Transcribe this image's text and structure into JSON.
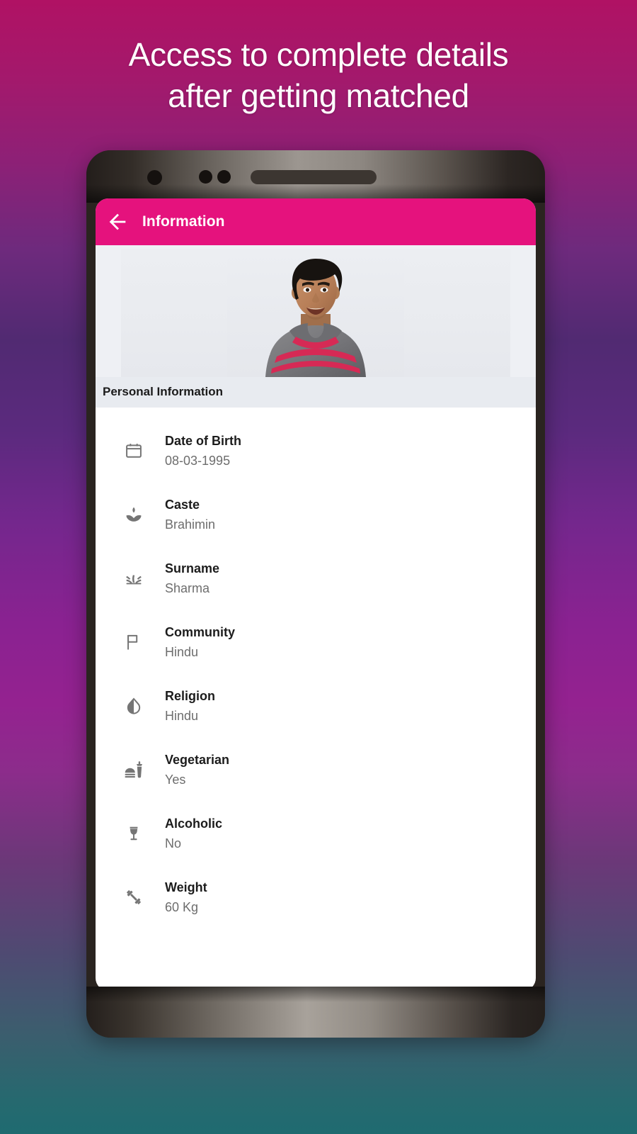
{
  "promo": {
    "headline_line1": "Access to complete details",
    "headline_line2": "after getting matched",
    "text_color": "#ffffff"
  },
  "theme": {
    "accent_pink": "#e5127d",
    "section_band": "#e8ebf0",
    "label_color": "#1c1c1c",
    "value_color": "#6d6d6d",
    "icon_color": "#6e6e6e",
    "bg_top": "#b01264",
    "bg_mid": "#8a2291",
    "bg_bottom": "#1f6b70"
  },
  "appbar": {
    "back_icon": "arrow-left-icon",
    "title": "Information"
  },
  "profile_photo": {
    "alt": "profile-photo-young-man-grey-hoodie"
  },
  "section": {
    "title": "Personal Information"
  },
  "details": [
    {
      "icon": "calendar-icon",
      "label": "Date of Birth",
      "value": "08-03-1995"
    },
    {
      "icon": "lotus-icon",
      "label": "Caste",
      "value": "Brahimin"
    },
    {
      "icon": "grass-icon",
      "label": "Surname",
      "value": "Sharma"
    },
    {
      "icon": "flag-icon",
      "label": "Community",
      "value": "Hindu"
    },
    {
      "icon": "droplet-icon",
      "label": "Religion",
      "value": "Hindu"
    },
    {
      "icon": "fastfood-icon",
      "label": "Vegetarian",
      "value": "Yes"
    },
    {
      "icon": "wineglass-icon",
      "label": "Alcoholic",
      "value": "No"
    },
    {
      "icon": "dumbbell-icon",
      "label": "Weight",
      "value": "60 Kg"
    }
  ]
}
